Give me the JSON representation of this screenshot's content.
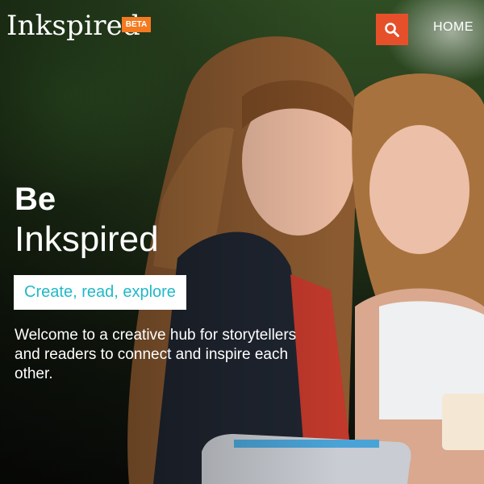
{
  "header": {
    "logo_text": "Inkspired",
    "beta_badge": "BETA",
    "search_icon": "search-icon",
    "nav": [
      {
        "label": "HOME"
      }
    ]
  },
  "hero": {
    "headline_line1": "Be",
    "headline_line2": "Inkspired",
    "tagline": "Create, read, explore",
    "description": "Welcome to a creative hub for storytellers and readers to connect and inspire each other."
  },
  "colors": {
    "accent_orange": "#f47a20",
    "search_red": "#e5502b",
    "tagline_teal": "#20b9c7"
  }
}
